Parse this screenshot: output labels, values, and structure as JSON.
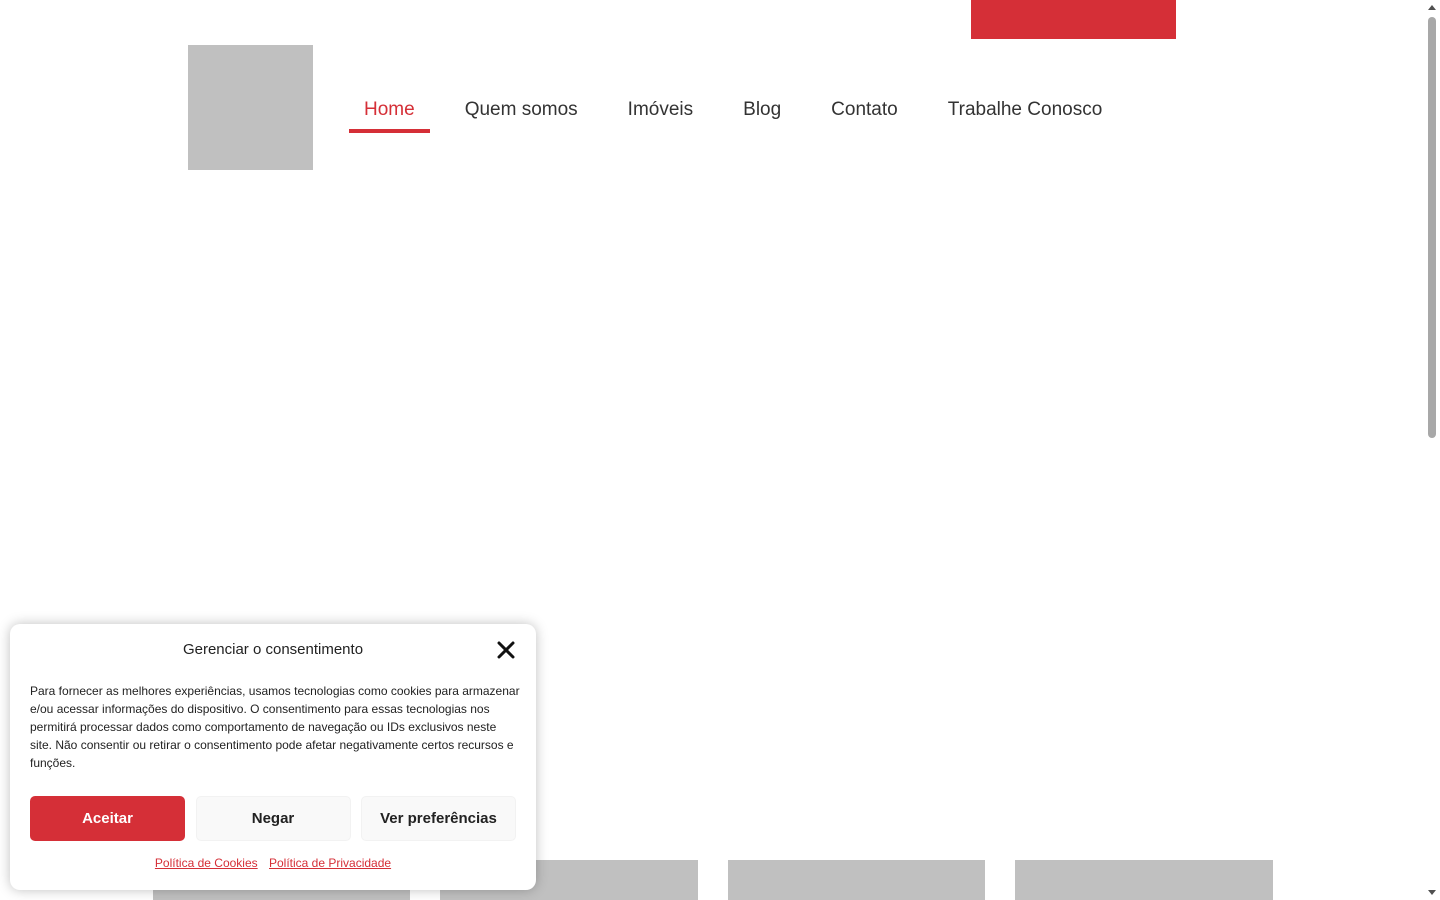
{
  "nav": {
    "items": [
      {
        "label": "Home",
        "active": true
      },
      {
        "label": "Quem somos",
        "active": false
      },
      {
        "label": "Imóveis",
        "active": false
      },
      {
        "label": "Blog",
        "active": false
      },
      {
        "label": "Contato",
        "active": false
      },
      {
        "label": "Trabalhe Conosco",
        "active": false
      }
    ]
  },
  "colors": {
    "accent": "#d52f37",
    "placeholder": "#c0c0c0",
    "text": "#333333"
  },
  "consent": {
    "title": "Gerenciar o consentimento",
    "close_icon": "close-icon",
    "body": "Para fornecer as melhores experiências, usamos tecnologias como cookies para armazenar e/ou acessar informações do dispositivo. O consentimento para essas tecnologias nos permitirá processar dados como comportamento de navegação ou IDs exclusivos neste site. Não consentir ou retirar o consentimento pode afetar negativamente certos recursos e funções.",
    "buttons": {
      "accept": "Aceitar",
      "deny": "Negar",
      "preferences": "Ver preferências"
    },
    "links": {
      "cookies": "Política de Cookies",
      "privacy": "Política de Privacidade"
    }
  }
}
